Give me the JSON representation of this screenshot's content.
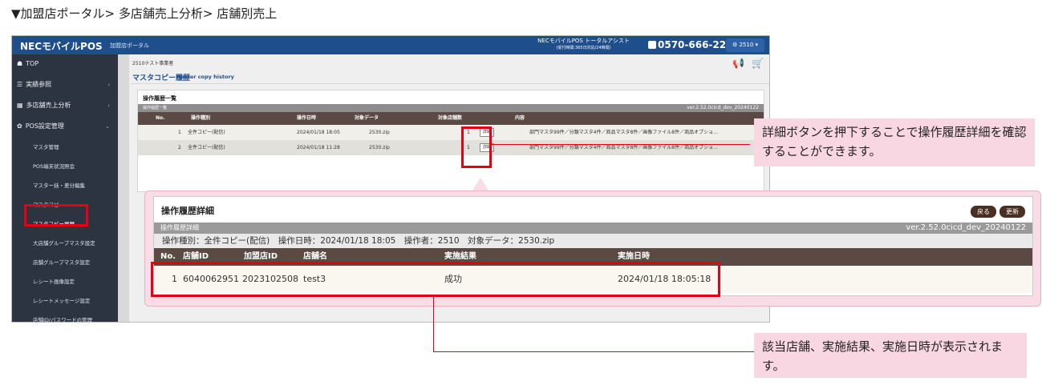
{
  "heading": "▼加盟店ポータル> 多店舗売上分析> 店舗別売上",
  "topbar": {
    "brand": "NECモバイルPOS",
    "portal": "加盟店ポータル",
    "support_line1": "NECモバイルPOS トータルアシスト",
    "support_line2": "(受付時間:365日対応/24時間)",
    "phone": "0570-666-221",
    "user": "⚙ 2510 ▾"
  },
  "sidebar": {
    "items": [
      {
        "icon": "☗",
        "label": "TOP",
        "chevron": ""
      },
      {
        "icon": "☰",
        "label": "実績参照",
        "chevron": "‹"
      },
      {
        "icon": "▦",
        "label": "多店舗売上分析",
        "chevron": "‹"
      },
      {
        "icon": "✿",
        "label": "POS設定管理",
        "chevron": "⌄"
      }
    ],
    "subitems": [
      "マスタ管理",
      "POS端末状況照会",
      "マスター括・差分編集",
      "マスタコピー",
      "マスタコピー履歴",
      "大店舗グループマスタ設定",
      "店舗グループマスタ設定",
      "レシート画像設定",
      "レシートメッセージ設定",
      "店舗ID/パスワードの管理"
    ]
  },
  "main": {
    "breadcrumb": "2510テスト事業者",
    "title": "マスタコピー履歴",
    "title_en": "Master copy history",
    "panel_title": "操作履歴一覧",
    "bar_label": "操作履歴一覧",
    "version": "ver.2.52.0cicd_dev_20240122",
    "columns": [
      "No.",
      "操作種別",
      "操作日時",
      "対象データ",
      "対象店舗数",
      "内容"
    ],
    "rows": [
      {
        "no": "1",
        "type": "全件コピー(配信)",
        "datetime": "2024/01/18 18:05",
        "data": "2530.zip",
        "count": "1",
        "detail": "詳細",
        "content": "部門マスタ99件／分類マスタ4件／商品マスタ8件／画像ファイル8件／商品オプショ…"
      },
      {
        "no": "2",
        "type": "全件コピー(配信)",
        "datetime": "2024/01/18 11:28",
        "data": "2530.zip",
        "count": "1",
        "detail": "詳細",
        "content": "部門マスタ99件／分類マスタ4件／商品マスタ8件／画像ファイル8件／商品オプショ…"
      }
    ]
  },
  "popup": {
    "title": "操作履歴詳細",
    "back": "戻る",
    "refresh": "更新",
    "bar_label": "操作履歴詳細",
    "version": "ver.2.52.0cicd_dev_20240122",
    "info": "操作種別：全件コピー(配信)　操作日時：2024/01/18 18:05　操作者：2510　対象データ：2530.zip",
    "columns": [
      "No.",
      "店舗ID",
      "加盟店ID",
      "店舗名",
      "実施結果",
      "実施日時"
    ],
    "row": {
      "no": "1",
      "store_id": "6040062951",
      "merchant_id": "2023102508",
      "store_name": "test3",
      "result": "成功",
      "datetime": "2024/01/18 18:05:18"
    }
  },
  "callouts": {
    "detail_button": "詳細ボタンを押下することで操作履歴詳細を確認することができます。",
    "result": "該当店舗、実施結果、実施日時が表示されます。"
  }
}
